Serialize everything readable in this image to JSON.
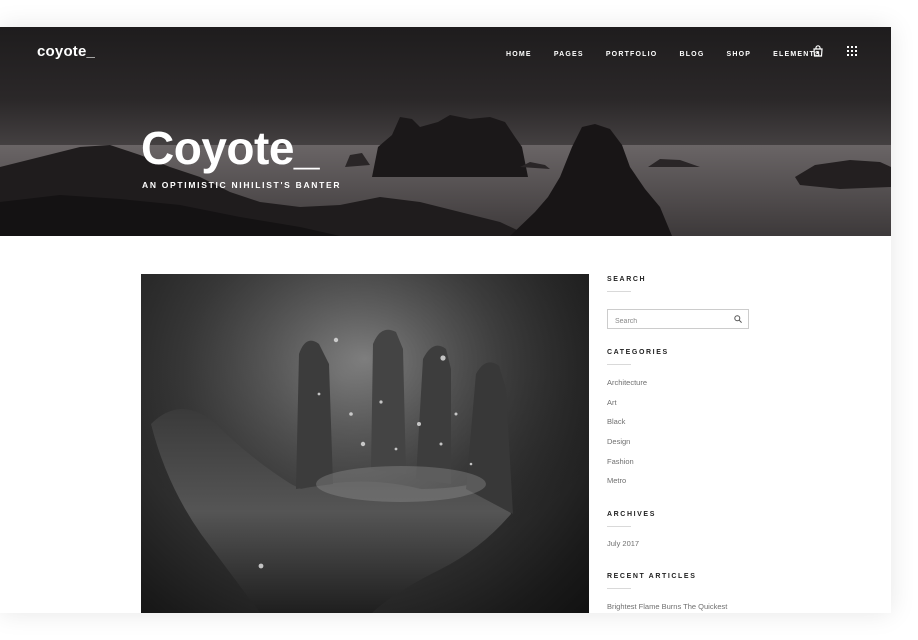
{
  "header": {
    "logo": "coyote_",
    "nav": [
      "HOME",
      "PAGES",
      "PORTFOLIO",
      "BLOG",
      "SHOP",
      "ELEMENTS"
    ],
    "icons": [
      "shopping-bag-icon",
      "grid-menu-icon"
    ]
  },
  "hero": {
    "title": "Coyote_",
    "subtitle": "AN OPTIMISTIC NIHILIST'S BANTER"
  },
  "sidebar": {
    "search": {
      "title": "SEARCH",
      "placeholder": "Search"
    },
    "categories": {
      "title": "CATEGORIES",
      "items": [
        "Architecture",
        "Art",
        "Black",
        "Design",
        "Fashion",
        "Metro"
      ]
    },
    "archives": {
      "title": "ARCHIVES",
      "items": [
        "July 2017"
      ]
    },
    "recent": {
      "title": "RECENT ARTICLES",
      "items": [
        "Brightest Flame Burns The Quickest"
      ]
    }
  },
  "colors": {
    "accent_text": "#222222",
    "link_text": "#6f6f6f",
    "hero_dark": "#2b2829"
  }
}
